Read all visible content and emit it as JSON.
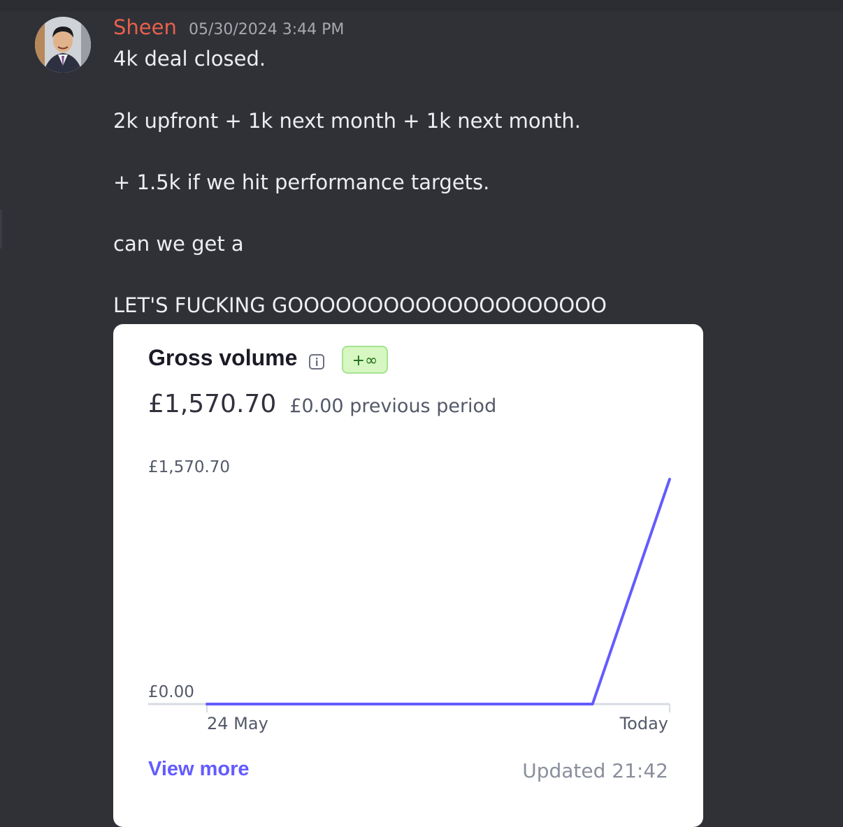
{
  "message": {
    "author": "Sheen",
    "timestamp": "05/30/2024 3:44 PM",
    "lines": [
      "4k deal closed.",
      "2k upfront + 1k next month + 1k next month.",
      "+ 1.5k if we hit performance targets.",
      "can we get a",
      "LET'S FUCKING GOOOOOOOOOOOOOOOOOOOO"
    ]
  },
  "card": {
    "title": "Gross volume",
    "badge": "+∞",
    "amount": "£1,570.70",
    "previous": "£0.00 previous period",
    "view_more": "View more",
    "updated": "Updated 21:42"
  },
  "chart_data": {
    "type": "line",
    "title": "Gross volume",
    "x_labels": [
      "24 May",
      "Today"
    ],
    "y_labels": [
      "£1,570.70",
      "£0.00"
    ],
    "ylim": [
      0,
      1570.7
    ],
    "series": [
      {
        "values": [
          0,
          0,
          0,
          0,
          0,
          0,
          1570.7
        ],
        "color": "#635bff"
      }
    ]
  },
  "colors": {
    "username": "#e8604c",
    "accent": "#635bff",
    "badge_bg": "#d7f7c2"
  },
  "icons": {
    "info": "info-icon"
  }
}
